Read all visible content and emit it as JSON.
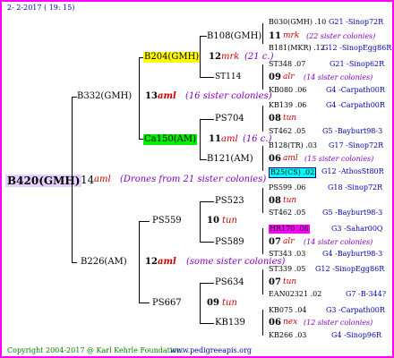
{
  "header": "2- 2-2017 ( 19: 15)",
  "footer_left": "Copyright 2004-2017 @ Karl Kehrle Foundation.",
  "footer_right": "www.pedigreeapis.org",
  "root": {
    "name": "B420(GMH)",
    "num": "14",
    "code": "aml",
    "desc": "(Drones from 21 sister colonies)"
  },
  "gen1": [
    {
      "name": "B332(GMH)",
      "num": "13",
      "code": "aml",
      "desc": "(16 sister colonies)"
    },
    {
      "name": "B226(AM)",
      "num": "12",
      "code": "aml",
      "desc": "(some sister colonies)"
    }
  ],
  "gen2": [
    {
      "name": "B204(GMH)",
      "num": "12",
      "code": "mrk",
      "desc": "(21 c.)"
    },
    {
      "name": "Ca150(AM)",
      "num": "11",
      "code": "aml",
      "desc": "(16 c.)"
    },
    {
      "name": "PS559",
      "num": "10",
      "code": "tun",
      "desc": ""
    },
    {
      "name": "PS667",
      "num": "09",
      "code": "tun",
      "desc": ""
    }
  ],
  "gen3": [
    {
      "name": "B108(GMH)",
      "num": "11",
      "code": "mrk",
      "desc": "(22 sister colonies)"
    },
    {
      "name": "ST114",
      "num": "09",
      "code": "alr",
      "desc": "(14 sister colonies)"
    },
    {
      "name": "PS704",
      "num": "08",
      "code": "tun",
      "desc": ""
    },
    {
      "name": "B121(AM)",
      "num": "06",
      "code": "aml",
      "desc": "(15 sister colonies)"
    },
    {
      "name": "PS523",
      "num": "08",
      "code": "tun",
      "desc": ""
    },
    {
      "name": "PS589",
      "num": "07",
      "code": "alr",
      "desc": "(14 sister colonies)"
    },
    {
      "name": "PS634",
      "num": "07",
      "code": "tun",
      "desc": ""
    },
    {
      "name": "KB139",
      "num": "06",
      "code": "nex",
      "desc": "(12 sister colonies)"
    }
  ],
  "gen4": [
    {
      "left": "B030(GMH) .10",
      "right": "G21 -Sinop72R"
    },
    {
      "left": "B181(MKR) .12",
      "right": "G12 -SinopEgg86R"
    },
    {
      "left": "ST348 .07",
      "right": "G21 -Sinop62R"
    },
    {
      "left": "KB080 .06",
      "right": "G4 -Carpath00R"
    },
    {
      "left": "KB139 .06",
      "right": "G4 -Carpath00R"
    },
    {
      "left": "ST462 .05",
      "right": "G5 -Bayburt98-3"
    },
    {
      "left": "B128(TR) .03",
      "right": "G17 -Sinop72R"
    },
    {
      "left": "B25(CS) .02",
      "right": "G12 -AthosSt80R"
    },
    {
      "left": "PS599 .06",
      "right": "G18 -Sinop72R"
    },
    {
      "left": "ST462 .05",
      "right": "G5 -Bayburt98-3"
    },
    {
      "left": "HR170 .06",
      "right": "G3 -Sahar00Q"
    },
    {
      "left": "ST343 .03",
      "right": "G4 -Bayburt98-3"
    },
    {
      "left": "ST339 .05",
      "right": "G12 -SinopEgg86R"
    },
    {
      "left": "EAN02321 .02",
      "right": "G7 -B-344?"
    },
    {
      "left": "KB075 .04",
      "right": "G3 -Carpath00R"
    },
    {
      "left": "KB266 .03",
      "right": "G4 -Sinop96R"
    }
  ]
}
